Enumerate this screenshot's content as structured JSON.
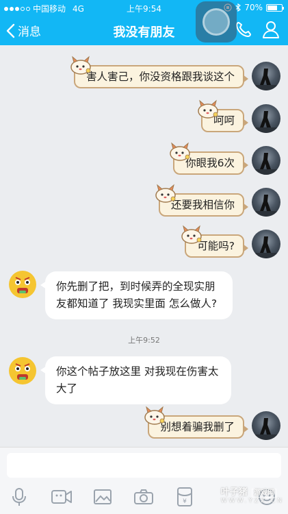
{
  "status_bar": {
    "carrier": "中国移动",
    "network": "4G",
    "time": "上午9:54",
    "battery": "70%",
    "battery_level": 0.7
  },
  "nav": {
    "back_label": "消息",
    "title": "我没有朋友"
  },
  "messages": [
    {
      "side": "right",
      "text": "害人害己，你没资格跟我谈这个"
    },
    {
      "side": "right",
      "text": "呵呵"
    },
    {
      "side": "right",
      "text": "你眼我6次"
    },
    {
      "side": "right",
      "text": "还要我相信你"
    },
    {
      "side": "right",
      "text": "可能吗?"
    },
    {
      "side": "left",
      "text": "你先删了把，到时候弄的全现实朋友都知道了 我现实里面 怎么做人?"
    },
    {
      "side": "left",
      "text": "你这个帖子放这里 对我现在伤害太大了"
    },
    {
      "side": "right",
      "text": "别想着骗我删了"
    }
  ],
  "timestamp": "上午9:52",
  "toolbar": {
    "icons": [
      "microphone-icon",
      "video-icon",
      "image-icon",
      "camera-icon",
      "red-packet-icon",
      "emoji-icon"
    ],
    "red_packet_symbol": "¥"
  },
  "watermark": {
    "main": "叶子猪",
    "badge": "游戏网",
    "url": "WWW.YZZ.CN"
  },
  "colors": {
    "nav_bg": "#12b7f5",
    "chat_bg": "#ebedf0",
    "right_bubble": "#fbf3df",
    "right_bubble_border": "#c9a67a",
    "left_bubble": "#ffffff"
  }
}
